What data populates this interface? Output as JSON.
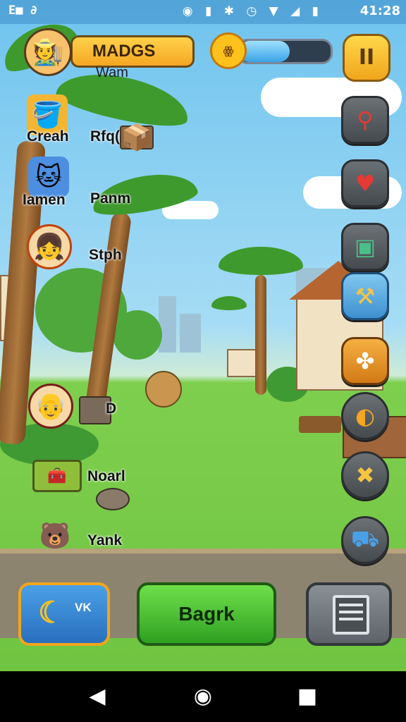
{
  "status_bar": {
    "left_text": "E■ ∂",
    "icons": "◉ ▮  ✱ ◷ ▼ ◢ ▮",
    "time": "41:28"
  },
  "hud": {
    "player_name": "MADGS",
    "player_subtitle": "Wam",
    "sun_label": "ꙮ",
    "energy_level": 0.55,
    "pause_label": "II"
  },
  "left_list": [
    {
      "label": "Creah",
      "icon": "bucket-icon",
      "glyph": "🪣",
      "bg": "#f4b632"
    },
    {
      "label": "Rfq(l",
      "icon": "crate-icon",
      "glyph": "📦",
      "bg": "transparent"
    },
    {
      "label": "Iamen",
      "icon": "blue-cat-icon",
      "glyph": "🐱",
      "bg": "#4c8fe0"
    },
    {
      "label": "Panm",
      "icon": "",
      "glyph": "",
      "bg": "transparent"
    },
    {
      "label": "Stph",
      "icon": "girl-avatar-icon",
      "glyph": "👧",
      "bg": "#f7d9a8"
    },
    {
      "label": "D",
      "icon": "old-man-icon",
      "glyph": "👴",
      "bg": "#f7d9a8"
    },
    {
      "label": "Noarl",
      "icon": "field-box-icon",
      "glyph": "🧰",
      "bg": "transparent"
    },
    {
      "label": "Yank",
      "icon": "bear-icon",
      "glyph": "🐻",
      "bg": "transparent"
    }
  ],
  "tools": [
    {
      "name": "shovel-tool-icon",
      "glyph": "🥄"
    },
    {
      "name": "heart-icon",
      "glyph": "♥"
    },
    {
      "name": "map-icon",
      "glyph": "🗺"
    },
    {
      "name": "hammer-icon",
      "glyph": "🔨"
    },
    {
      "name": "cookie-icon",
      "glyph": "🍪"
    },
    {
      "name": "moon-coin-icon",
      "glyph": "◐"
    },
    {
      "name": "cross-tools-icon",
      "glyph": "✖"
    },
    {
      "name": "truck-icon",
      "glyph": "🚚"
    }
  ],
  "bottom_bar": {
    "left_label": "VK",
    "middle_label": "Bagrk"
  },
  "colors": {
    "accent": "#f5a623",
    "primary_green": "#2ea022",
    "sky": "#6ec3ee"
  }
}
